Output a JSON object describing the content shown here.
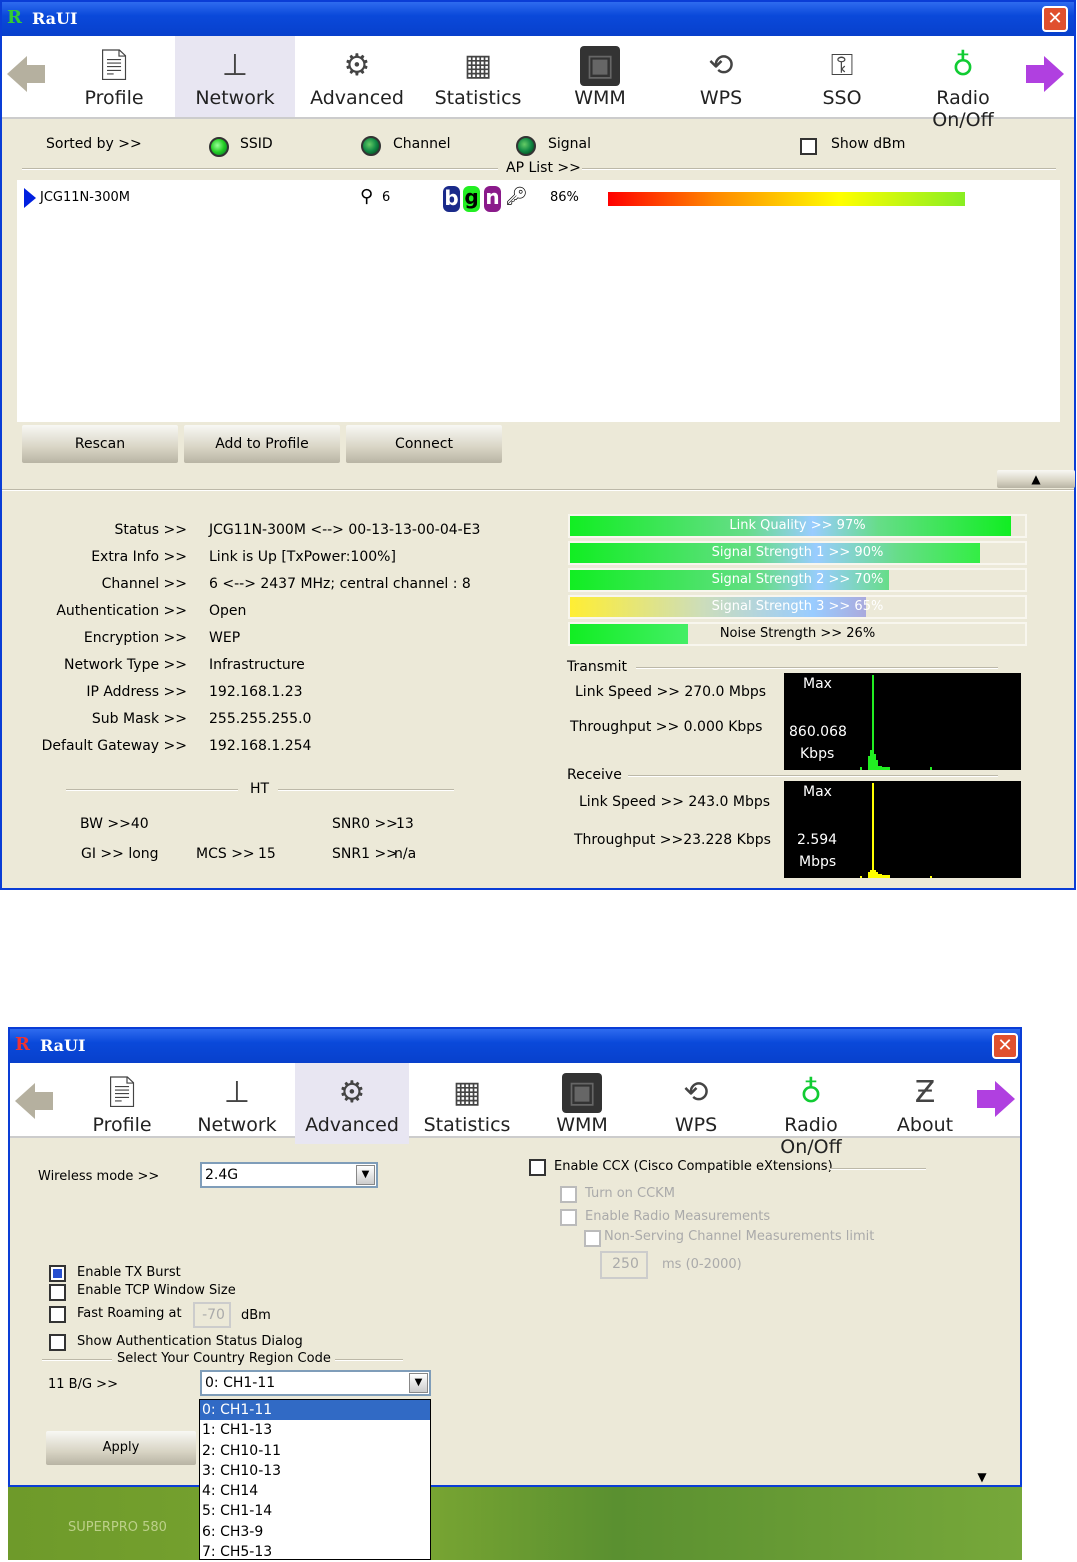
{
  "window1": {
    "title": "RaUI",
    "toolbar": [
      {
        "label": "Profile",
        "icon": "profile-icon"
      },
      {
        "label": "Network",
        "icon": "network-icon",
        "selected": true
      },
      {
        "label": "Advanced",
        "icon": "advanced-icon"
      },
      {
        "label": "Statistics",
        "icon": "statistics-icon"
      },
      {
        "label": "WMM",
        "icon": "wmm-icon"
      },
      {
        "label": "WPS",
        "icon": "wps-icon"
      },
      {
        "label": "SSO",
        "icon": "sso-icon"
      },
      {
        "label": "Radio On/Off",
        "icon": "radio-icon"
      }
    ],
    "sort": {
      "label": "Sorted by >>",
      "ssid": "SSID",
      "channel": "Channel",
      "signal": "Signal",
      "show_dbm": "Show dBm",
      "ap_list": "AP List >>"
    },
    "ap_list": [
      {
        "ssid": "JCG11N-300M",
        "channel": "6",
        "modes": [
          "b",
          "g",
          "n"
        ],
        "signal": "86%",
        "signal_fraction": 0.86
      }
    ],
    "buttons": {
      "rescan": "Rescan",
      "add_profile": "Add to Profile",
      "connect": "Connect"
    },
    "info": [
      {
        "label": "Status >>",
        "value": "JCG11N-300M <--> 00-13-13-00-04-E3"
      },
      {
        "label": "Extra Info >>",
        "value": "Link is Up [TxPower:100%]"
      },
      {
        "label": "Channel >>",
        "value": "6 <--> 2437 MHz; central channel : 8"
      },
      {
        "label": "Authentication >>",
        "value": "Open"
      },
      {
        "label": "Encryption >>",
        "value": "WEP"
      },
      {
        "label": "Network Type >>",
        "value": "Infrastructure"
      },
      {
        "label": "IP Address >>",
        "value": "192.168.1.23"
      },
      {
        "label": "Sub Mask >>",
        "value": "255.255.255.0"
      },
      {
        "label": "Default Gateway >>",
        "value": "192.168.1.254"
      }
    ],
    "ht": {
      "title": "HT",
      "bw": "BW >>40",
      "gi": "GI >> long",
      "mcs_label": "MCS >>",
      "mcs": "15",
      "snr0_label": "SNR0 >>",
      "snr0": "13",
      "snr1_label": "SNR1 >>",
      "snr1": "n/a"
    },
    "bars": [
      {
        "label": "Link Quality >> 97%",
        "value": 97
      },
      {
        "label": "Signal Strength 1 >> 90%",
        "value": 90
      },
      {
        "label": "Signal Strength 2 >> 70%",
        "value": 70
      },
      {
        "label": "Signal Strength 3 >> 65%",
        "value": 65
      },
      {
        "label": "Noise Strength >> 26%",
        "value": 26
      }
    ],
    "transmit": {
      "title": "Transmit",
      "link_speed": "Link Speed >>  270.0 Mbps",
      "throughput": "Throughput >> 0.000 Kbps",
      "max": "Max",
      "max_value": "860.068",
      "unit": "Kbps"
    },
    "receive": {
      "title": "Receive",
      "link_speed": "Link Speed >> 243.0 Mbps",
      "throughput": "Throughput >>23.228 Kbps",
      "max": "Max",
      "max_value": "2.594",
      "unit": "Mbps"
    }
  },
  "window2": {
    "title": "RaUI",
    "toolbar": [
      {
        "label": "Profile",
        "icon": "profile-icon"
      },
      {
        "label": "Network",
        "icon": "network-icon"
      },
      {
        "label": "Advanced",
        "icon": "advanced-icon",
        "selected": true
      },
      {
        "label": "Statistics",
        "icon": "statistics-icon"
      },
      {
        "label": "WMM",
        "icon": "wmm-icon"
      },
      {
        "label": "WPS",
        "icon": "wps-icon"
      },
      {
        "label": "Radio On/Off",
        "icon": "radio-icon"
      },
      {
        "label": "About",
        "icon": "about-icon"
      }
    ],
    "wireless_mode_label": "Wireless mode >>",
    "wireless_mode": "2.4G",
    "tx_burst": "Enable TX Burst",
    "tcp_window": "Enable TCP Window Size",
    "fast_roaming": "Fast Roaming at",
    "fast_roaming_value": "-70",
    "dbm": "dBm",
    "auth_dialog": "Show Authentication Status Dialog",
    "country_title": "Select Your Country Region Code",
    "bg_label": "11 B/G >>",
    "bg_value": "0: CH1-11",
    "bg_options": [
      "0: CH1-11",
      "1: CH1-13",
      "2: CH10-11",
      "3: CH10-13",
      "4: CH14",
      "5: CH1-14",
      "6: CH3-9",
      "7: CH5-13"
    ],
    "apply": "Apply",
    "ccx": "Enable CCX (Cisco Compatible eXtensions)",
    "cckm": "Turn on CCKM",
    "radio_meas": "Enable Radio Measurements",
    "non_serving": "Non-Serving Channel Measurements limit",
    "ms_value": "250",
    "ms_unit": "ms (0-2000)"
  },
  "desktop_label": "SUPERPRO 580"
}
